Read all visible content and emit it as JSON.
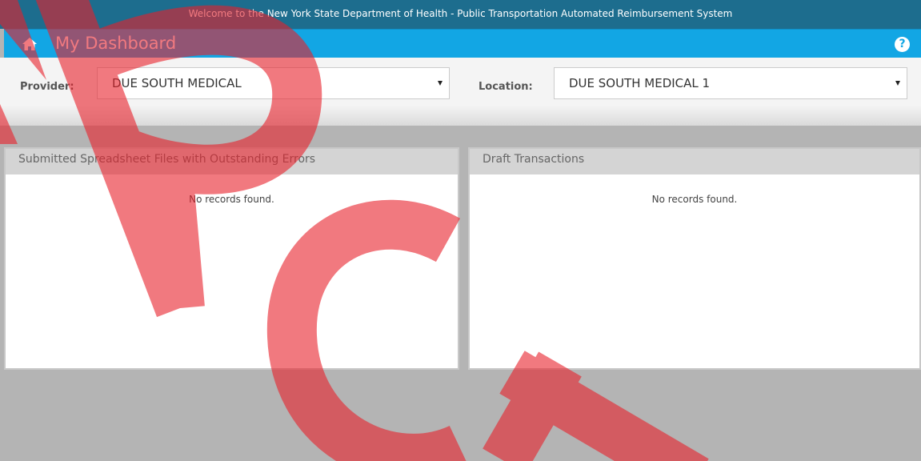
{
  "banner": {
    "text": "Welcome to the New York State Department of Health - Public Transportation Automated Reimbursement System"
  },
  "header": {
    "title": "My Dashboard",
    "home_icon": "home-icon",
    "help_icon": "help-icon",
    "help_glyph": "?"
  },
  "filters": {
    "provider_label": "Provider:",
    "provider_value": "DUE SOUTH MEDICAL",
    "location_label": "Location:",
    "location_value": "DUE SOUTH MEDICAL 1"
  },
  "panels": [
    {
      "title": "Submitted Spreadsheet Files with Outstanding Errors",
      "empty_text": "No records found."
    },
    {
      "title": "Draft Transactions",
      "empty_text": "No records found."
    }
  ],
  "colors": {
    "banner": "#1d6d8e",
    "titlebar": "#12a6e4",
    "watermark": "#e8202a"
  }
}
